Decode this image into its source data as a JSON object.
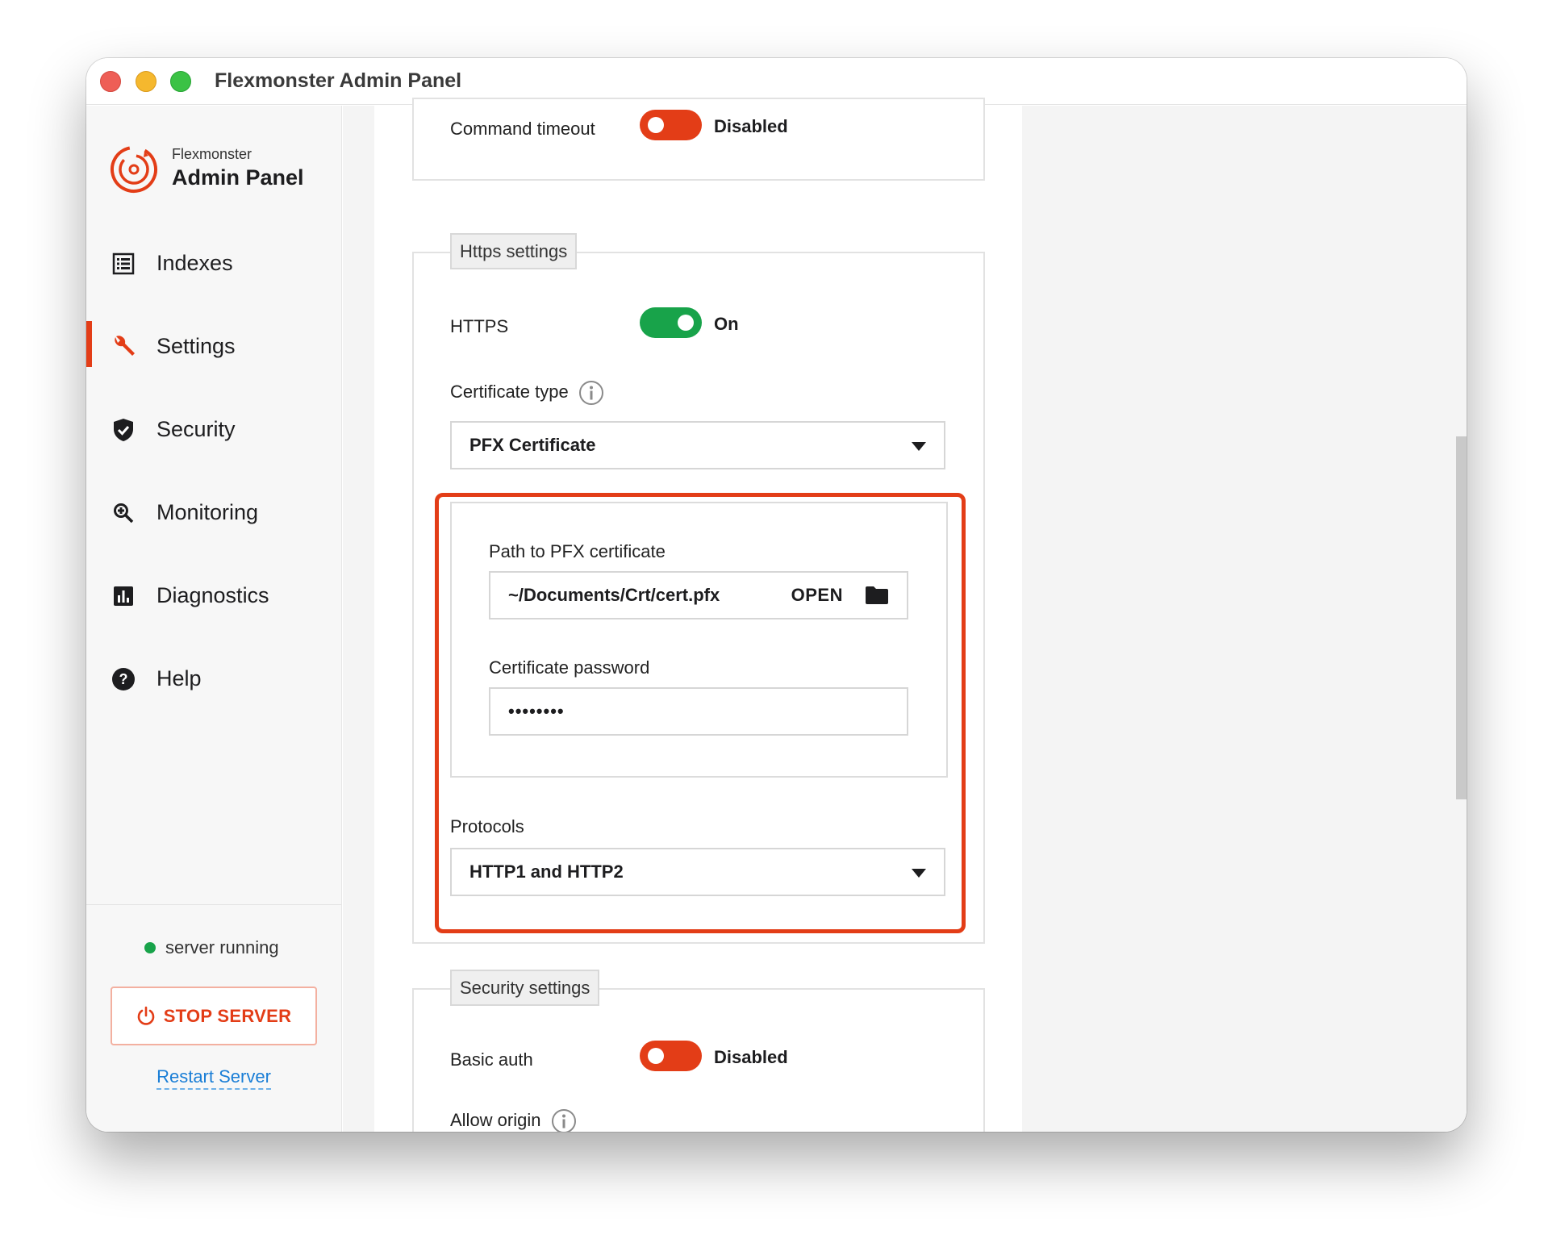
{
  "window": {
    "title": "Flexmonster Admin Panel"
  },
  "brand": {
    "small": "Flexmonster",
    "big": "Admin Panel",
    "accent": "#e33d17"
  },
  "nav": {
    "items": [
      {
        "label": "Indexes",
        "icon": "list-icon",
        "active": false
      },
      {
        "label": "Settings",
        "icon": "wrench-icon",
        "active": true
      },
      {
        "label": "Security",
        "icon": "shield-icon",
        "active": false
      },
      {
        "label": "Monitoring",
        "icon": "search-icon",
        "active": false
      },
      {
        "label": "Diagnostics",
        "icon": "bar-chart-icon",
        "active": false
      },
      {
        "label": "Help",
        "icon": "help-icon",
        "active": false
      }
    ]
  },
  "footer": {
    "status": "server running",
    "status_color": "#18a34a",
    "stop_label": "STOP SERVER",
    "restart_label": "Restart Server"
  },
  "settings": {
    "command_timeout": {
      "label": "Command timeout",
      "state": "Disabled"
    },
    "https_section": {
      "legend": "Https settings",
      "https": {
        "label": "HTTPS",
        "state": "On"
      },
      "certificate_type": {
        "label": "Certificate type",
        "value": "PFX Certificate"
      },
      "pfx_path": {
        "label": "Path to PFX certificate",
        "value": "~/Documents/Crt/cert.pfx",
        "open_label": "OPEN"
      },
      "password": {
        "label": "Certificate password",
        "value": "••••••••"
      },
      "protocols": {
        "label": "Protocols",
        "value": "HTTP1 and HTTP2"
      }
    },
    "security_section": {
      "legend": "Security settings",
      "basic_auth": {
        "label": "Basic auth",
        "state": "Disabled"
      },
      "allow_origin": {
        "label": "Allow origin"
      }
    }
  }
}
